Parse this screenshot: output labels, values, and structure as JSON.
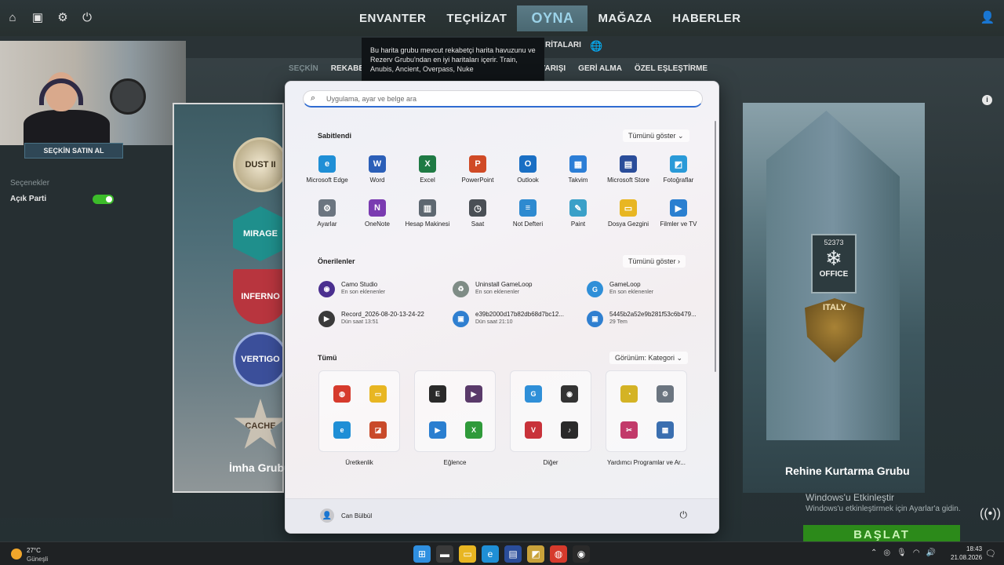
{
  "game": {
    "nav_tabs": [
      "ENVANTER",
      "TEÇHİZAT",
      "OYNA",
      "MAĞAZA",
      "HABERLER"
    ],
    "active_tab": "OYNA",
    "mode_tabs": {
      "seckin": "SEÇKİN",
      "rekabetci": "REKABET",
      "silah_yarisi": "SİLAH YARIŞI",
      "geri_alma": "GERİ ALMA",
      "ozel_eslestirme": "ÖZEL EŞLEŞTİRME"
    },
    "maps_heading": "RİTALARI",
    "tooltip": "Bu harita grubu mevcut rekabetçi harita havuzunu ve Rezerv Grubu'ndan en iyi haritaları içerir. Train, Anubis, Ancient, Overpass, Nuke",
    "prime_button": "SEÇKİN SATIN AL",
    "options_label": "Seçenekler",
    "open_party_label": "Açık Parti",
    "open_party_enabled": true,
    "map_badges": [
      "DUST II",
      "MIRAGE",
      "INFERNO",
      "VERTIGO",
      "CACHE"
    ],
    "left_card_label": "İmha Grubu A",
    "office_badge_number": "52373",
    "office_badge_text": "OFFICE",
    "italy_badge_text": "ITALY",
    "right_card_label": "Rehine Kurtarma Grubu",
    "start_button": "BAŞLAT",
    "windows_activate_title": "Windows'u Etkinleştir",
    "windows_activate_sub": "Windows'u etkinleştirmek için Ayarlar'a gidin."
  },
  "start_menu": {
    "search_placeholder": "Uygulama, ayar ve belge ara",
    "pinned_title": "Sabitlendi",
    "show_all": "Tümünü göster",
    "pinned": [
      {
        "label": "Microsoft Edge",
        "icon": "edge-icon",
        "color": "#1f8fd6",
        "glyph": "e"
      },
      {
        "label": "Word",
        "icon": "word-icon",
        "color": "#2b5fb8",
        "glyph": "W"
      },
      {
        "label": "Excel",
        "icon": "excel-icon",
        "color": "#1f7a44",
        "glyph": "X"
      },
      {
        "label": "PowerPoint",
        "icon": "powerpoint-icon",
        "color": "#d04a26",
        "glyph": "P"
      },
      {
        "label": "Outlook",
        "icon": "outlook-icon",
        "color": "#1a6fc4",
        "glyph": "O"
      },
      {
        "label": "Takvim",
        "icon": "calendar-icon",
        "color": "#2c7ed6",
        "glyph": "▦"
      },
      {
        "label": "Microsoft Store",
        "icon": "store-icon",
        "color": "#2a4d9a",
        "glyph": "▤"
      },
      {
        "label": "Fotoğraflar",
        "icon": "photos-icon",
        "color": "#2a9ad8",
        "glyph": "◩"
      },
      {
        "label": "Ayarlar",
        "icon": "settings-icon",
        "color": "#6b7580",
        "glyph": "⚙"
      },
      {
        "label": "OneNote",
        "icon": "onenote-icon",
        "color": "#7a3bb1",
        "glyph": "N"
      },
      {
        "label": "Hesap Makinesi",
        "icon": "calculator-icon",
        "color": "#5d6770",
        "glyph": "▥"
      },
      {
        "label": "Saat",
        "icon": "clock-icon",
        "color": "#4a4f55",
        "glyph": "◷"
      },
      {
        "label": "Not Defteri",
        "icon": "notepad-icon",
        "color": "#2e8ad0",
        "glyph": "≡"
      },
      {
        "label": "Paint",
        "icon": "paint-icon",
        "color": "#3aa0c8",
        "glyph": "✎"
      },
      {
        "label": "Dosya Gezgini",
        "icon": "file-explorer-icon",
        "color": "#e8b622",
        "glyph": "▭"
      },
      {
        "label": "Filmler ve TV",
        "icon": "movies-tv-icon",
        "color": "#2a7fd0",
        "glyph": "▶"
      }
    ],
    "recommended_title": "Önerilenler",
    "recommended": [
      {
        "name": "Camo Studio",
        "sub": "En son eklenenler",
        "icon": "camo-studio-icon",
        "color": "#4a2f8f",
        "glyph": "◉"
      },
      {
        "name": "Uninstall GameLoop",
        "sub": "En son eklenenler",
        "icon": "recycle-bin-icon",
        "color": "#7f8c86",
        "glyph": "♻"
      },
      {
        "name": "GameLoop",
        "sub": "En son eklenenler",
        "icon": "gameloop-icon",
        "color": "#2f8fd8",
        "glyph": "G"
      },
      {
        "name": "Record_2026-08-20-13-24-22",
        "sub": "Dün saat 13:51",
        "icon": "video-file-icon",
        "color": "#3a3a3a",
        "glyph": "▶"
      },
      {
        "name": "e39b2000d17b82db68d7bc12...",
        "sub": "Dün saat 21:10",
        "icon": "image-file-icon",
        "color": "#2f7fd0",
        "glyph": "▣"
      },
      {
        "name": "5445b2a52e9b281f53c6b479...",
        "sub": "29 Tem",
        "icon": "image-file-icon",
        "color": "#2f7fd0",
        "glyph": "▣"
      }
    ],
    "all_title": "Tümü",
    "view_label": "Görünüm: Kategori",
    "folders": [
      {
        "label": "Üretkenlik",
        "icons": [
          {
            "name": "chrome-icon",
            "color": "#d63a2c",
            "glyph": "◍"
          },
          {
            "name": "folder-icon",
            "color": "#e8b622",
            "glyph": "▭"
          },
          {
            "name": "edge-icon",
            "color": "#1f8fd6",
            "glyph": "e"
          },
          {
            "name": "office-icon",
            "color": "#c94a2a",
            "glyph": "◪"
          }
        ]
      },
      {
        "label": "Eğlence",
        "icons": [
          {
            "name": "epic-games-icon",
            "color": "#2a2a2a",
            "glyph": "E"
          },
          {
            "name": "media-player-icon",
            "color": "#5a3a6a",
            "glyph": "▶"
          },
          {
            "name": "movies-tv-icon",
            "color": "#2a7fd0",
            "glyph": "▶"
          },
          {
            "name": "xbox-icon",
            "color": "#2f9a3a",
            "glyph": "X"
          }
        ]
      },
      {
        "label": "Diğer",
        "icons": [
          {
            "name": "gameloop-icon",
            "color": "#2f8fd8",
            "glyph": "G"
          },
          {
            "name": "obs-icon",
            "color": "#333333",
            "glyph": "◉"
          },
          {
            "name": "valorant-icon",
            "color": "#c8323a",
            "glyph": "V"
          },
          {
            "name": "tiktok-icon",
            "color": "#2a2a2a",
            "glyph": "♪"
          }
        ]
      },
      {
        "label": "Yardımcı Programlar ve Ar...",
        "icons": [
          {
            "name": "keyring-icon",
            "color": "#d4b325",
            "glyph": "◔"
          },
          {
            "name": "settings-icon",
            "color": "#6b7580",
            "glyph": "⚙"
          },
          {
            "name": "snipping-tool-icon",
            "color": "#c23a6a",
            "glyph": "✂"
          },
          {
            "name": "control-panel-icon",
            "color": "#3a6fb0",
            "glyph": "▦"
          }
        ]
      }
    ],
    "user_name": "Can Bülbül"
  },
  "taskbar": {
    "temperature": "27°C",
    "condition": "Güneşli",
    "icons": [
      {
        "name": "start-icon",
        "color": "#2f8fe0",
        "glyph": "⊞"
      },
      {
        "name": "terminal-icon",
        "color": "#3a3a3a",
        "glyph": "▬"
      },
      {
        "name": "file-explorer-icon",
        "color": "#e8b622",
        "glyph": "▭"
      },
      {
        "name": "edge-icon",
        "color": "#1f8fd6",
        "glyph": "e"
      },
      {
        "name": "store-icon",
        "color": "#2a4d9a",
        "glyph": "▤"
      },
      {
        "name": "task-app-icon",
        "color": "#c9a23a",
        "glyph": "◩"
      },
      {
        "name": "chrome-icon",
        "color": "#d63a2c",
        "glyph": "◍"
      },
      {
        "name": "record-icon",
        "color": "#2a2a2a",
        "glyph": "◉"
      }
    ],
    "time": "18:43",
    "date": "21.08.2026"
  }
}
